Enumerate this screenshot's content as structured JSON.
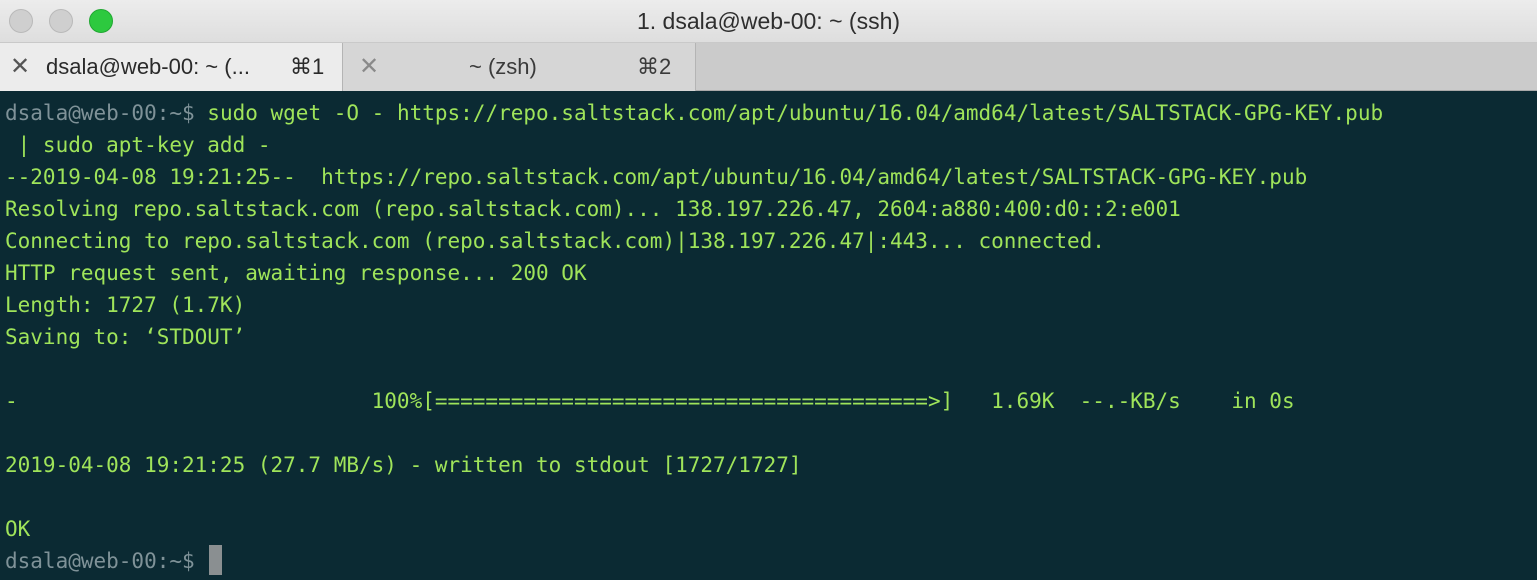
{
  "window": {
    "title": "1. dsala@web-00: ~ (ssh)"
  },
  "tabs": [
    {
      "label": "dsala@web-00: ~ (...",
      "shortcut": "⌘1",
      "close": "✕"
    },
    {
      "label": "~ (zsh)",
      "shortcut": "⌘2",
      "close": "✕"
    }
  ],
  "terminal": {
    "prompt": "dsala@web-00:~$",
    "command": " sudo wget -O - https://repo.saltstack.com/apt/ubuntu/16.04/amd64/latest/SALTSTACK-GPG-KEY.pub",
    "command_cont": " | sudo apt-key add -",
    "output": [
      "--2019-04-08 19:21:25--  https://repo.saltstack.com/apt/ubuntu/16.04/amd64/latest/SALTSTACK-GPG-KEY.pub",
      "Resolving repo.saltstack.com (repo.saltstack.com)... 138.197.226.47, 2604:a880:400:d0::2:e001",
      "Connecting to repo.saltstack.com (repo.saltstack.com)|138.197.226.47|:443... connected.",
      "HTTP request sent, awaiting response... 200 OK",
      "Length: 1727 (1.7K)",
      "Saving to: ‘STDOUT’",
      "",
      "-                            100%[=======================================>]   1.69K  --.-KB/s    in 0s",
      "",
      "2019-04-08 19:21:25 (27.7 MB/s) - written to stdout [1727/1727]",
      "",
      "OK"
    ],
    "final_prompt": "dsala@web-00:~$"
  },
  "colors": {
    "terminal_bg": "#0b2a33",
    "output_text": "#9fe45a",
    "prompt_text": "#7f9298",
    "maximize_button": "#2dc93f"
  }
}
